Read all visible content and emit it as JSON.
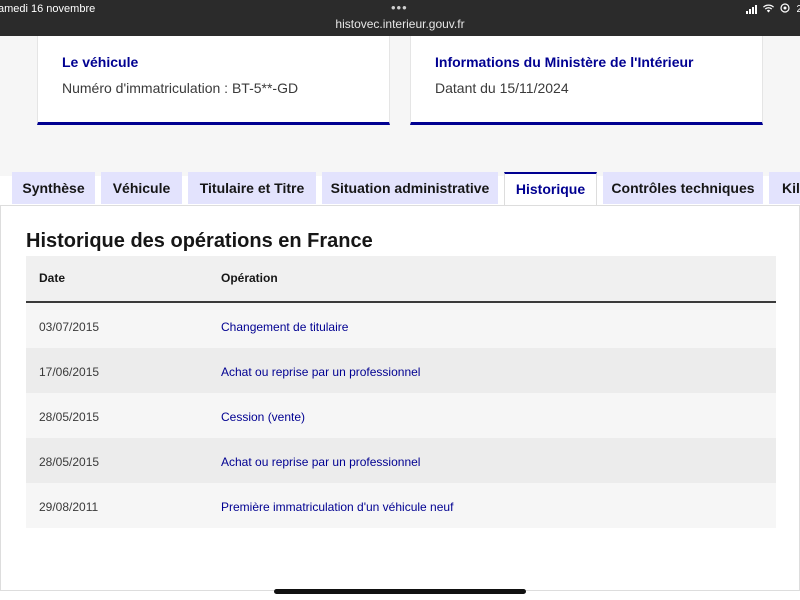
{
  "statusbar": {
    "date": "amedi 16 novembre",
    "dots": "•••",
    "url": "histovec.interieur.gouv.fr",
    "battery_partial": "2"
  },
  "cards": {
    "vehicle": {
      "title": "Le véhicule",
      "text": "Numéro d'immatriculation : BT-5**-GD"
    },
    "ministry": {
      "title": "Informations du Ministère de l'Intérieur",
      "text": "Datant du 15/11/2024"
    }
  },
  "tabs": [
    {
      "label": "Synthèse"
    },
    {
      "label": "Véhicule"
    },
    {
      "label": "Titulaire et Titre"
    },
    {
      "label": "Situation administrative"
    },
    {
      "label": "Historique"
    },
    {
      "label": "Contrôles techniques"
    },
    {
      "label": "Kilo"
    }
  ],
  "history": {
    "title": "Historique des opérations en France",
    "columns": {
      "date": "Date",
      "operation": "Opération"
    },
    "rows": [
      {
        "date": "03/07/2015",
        "operation": "Changement de titulaire"
      },
      {
        "date": "17/06/2015",
        "operation": "Achat ou reprise par un professionnel"
      },
      {
        "date": "28/05/2015",
        "operation": "Cession (vente)"
      },
      {
        "date": "28/05/2015",
        "operation": "Achat ou reprise par un professionnel"
      },
      {
        "date": "29/08/2011",
        "operation": "Première immatriculation d'un véhicule neuf"
      }
    ]
  },
  "colors": {
    "accent": "#000091",
    "tab_bg": "#e3e3fd"
  }
}
